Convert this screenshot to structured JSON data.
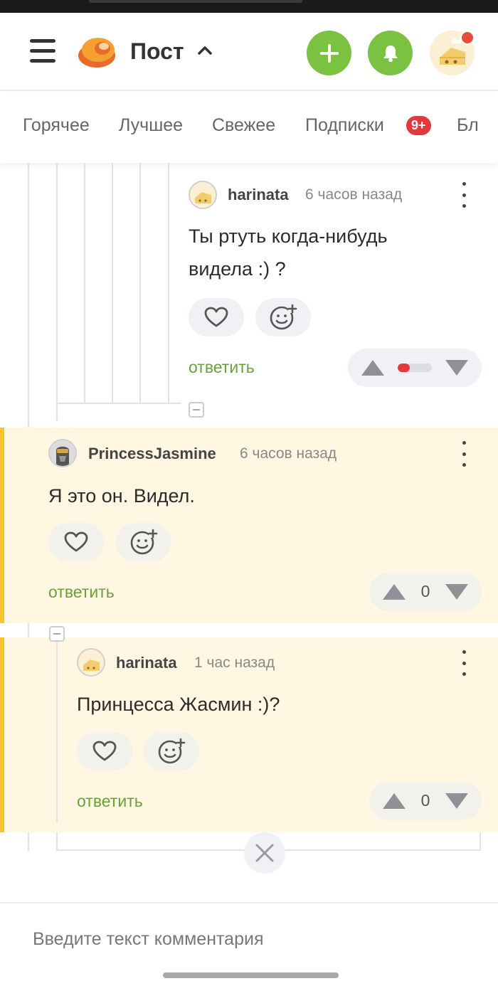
{
  "header": {
    "title": "Пост",
    "title_chevron": "^",
    "menu_icon": "hamburger-menu-icon",
    "logo_icon": "pikabu-logo-icon",
    "add_icon": "plus-icon",
    "notifications_icon": "bell-icon",
    "avatar_has_notification": true,
    "accent_color": "#7cc242"
  },
  "tabs": [
    {
      "label": "Горячее"
    },
    {
      "label": "Лучшее"
    },
    {
      "label": "Свежее"
    },
    {
      "label": "Подписки",
      "badge": "9+"
    },
    {
      "label": "Бл"
    }
  ],
  "comments": [
    {
      "author": "harinata",
      "time": "6 часов назад",
      "text_lines": [
        "Ты ртуть когда-нибудь",
        "видела :) ?"
      ],
      "reply_label": "ответить",
      "rating_display": "bar",
      "rating_bar_fraction": 0.35,
      "highlighted": false
    },
    {
      "author": "PrincessJasmine",
      "time": "6 часов назад",
      "text_lines": [
        "Я это он. Видел."
      ],
      "reply_label": "ответить",
      "rating": "0",
      "highlighted": true
    },
    {
      "author": "harinata",
      "time": "1 час назад",
      "text_lines": [
        "Принцесса Жасмин :)?"
      ],
      "reply_label": "ответить",
      "rating": "0",
      "highlighted": true
    }
  ],
  "composer": {
    "placeholder": "Введите текст комментария"
  },
  "colors": {
    "highlight_bg": "#fff7e2",
    "accent_yellow": "#f6c62d",
    "reply_green": "#6aa13a",
    "badge_red": "#e0393e"
  }
}
